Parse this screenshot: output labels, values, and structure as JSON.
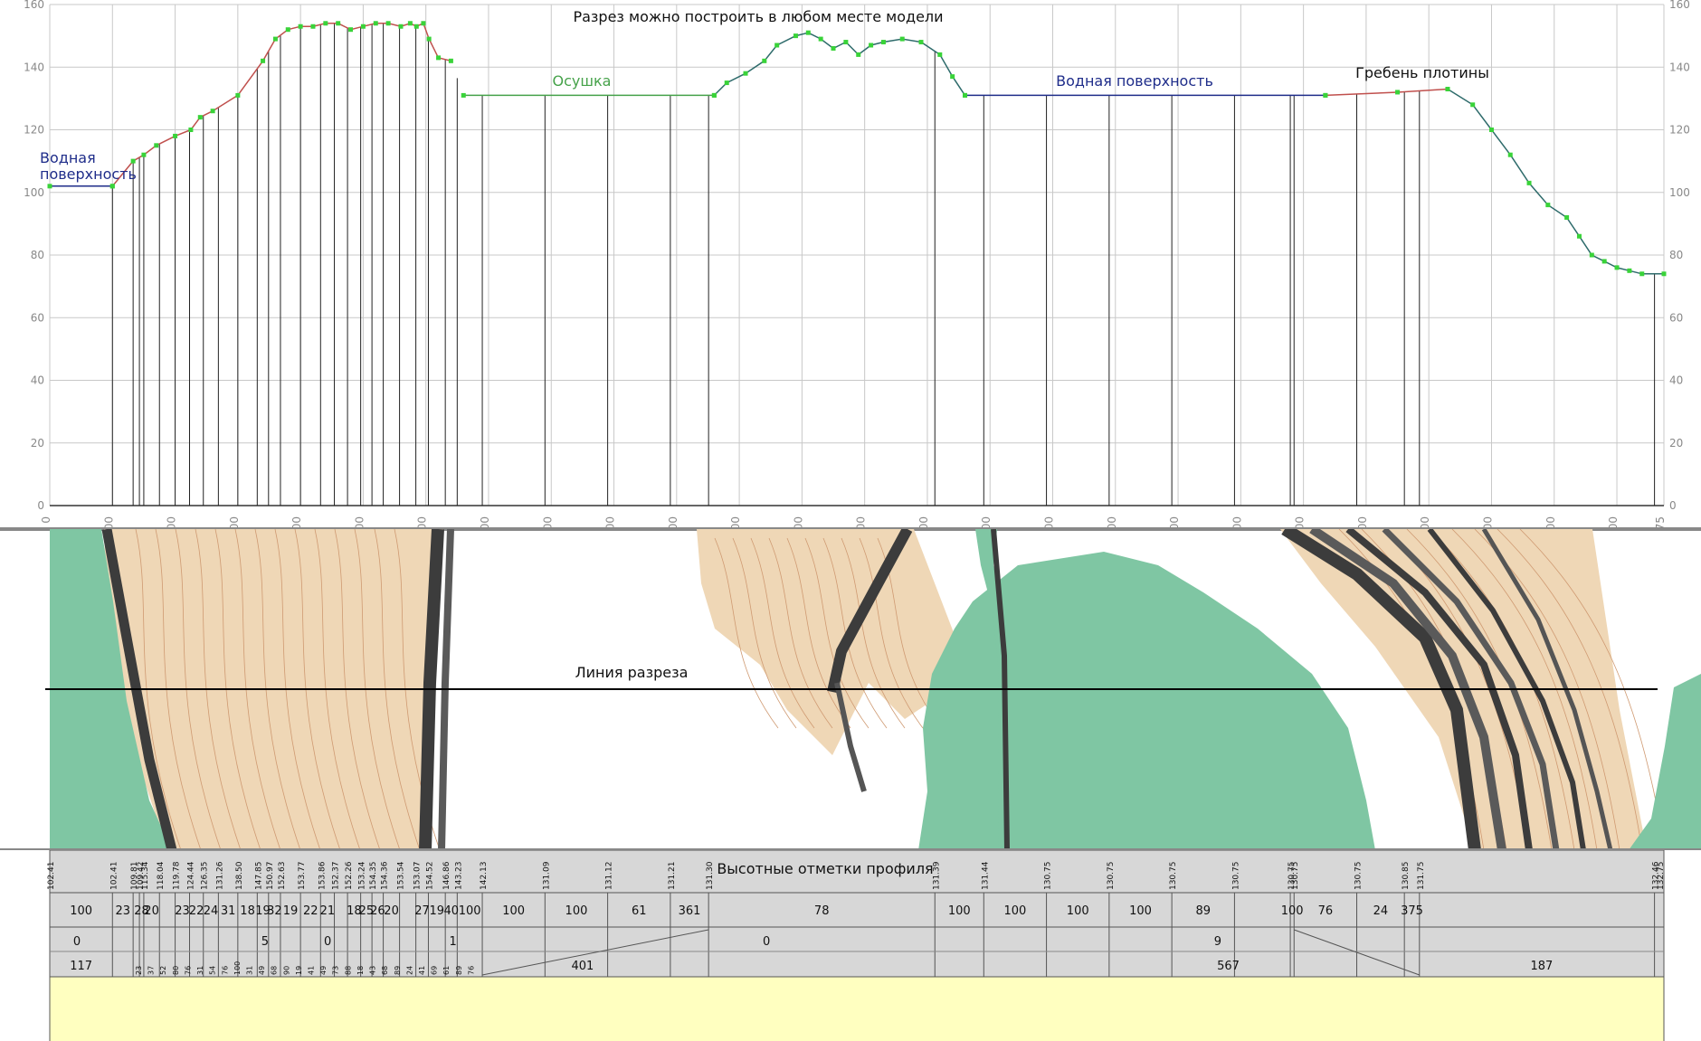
{
  "profile": {
    "title": "Разрез можно построить в любом месте модели",
    "annotations": {
      "water_left_line1": "Водная",
      "water_left_line2": "поверхность",
      "drainage": "Осушка",
      "water_right": "Водная поверхность",
      "dam_crest": "Гребень плотины"
    },
    "y_ticks": [
      "0",
      "20",
      "40",
      "60",
      "80",
      "100",
      "120",
      "140",
      "160"
    ],
    "x_ticks": [
      "0",
      "100",
      "200",
      "300",
      "400",
      "500",
      "600",
      "700",
      "800",
      "900",
      "1000",
      "1100",
      "1200",
      "1300",
      "1400",
      "1500",
      "1600",
      "1700",
      "1800",
      "1900",
      "2000",
      "2100",
      "2200",
      "2300",
      "2400",
      "2500",
      "2575"
    ],
    "colors": {
      "terrain": "#c0504d",
      "water": "#1f2d8a",
      "drain": "#46a24a",
      "natural": "#2e6b6b",
      "points": "#39d339",
      "grid": "#c8c8c8"
    }
  },
  "chart_data": {
    "type": "line",
    "title": "Разрез можно построить в любом месте модели",
    "xlabel": "",
    "ylabel": "",
    "xlim": [
      0,
      2575
    ],
    "ylim": [
      0,
      160
    ],
    "grid": true,
    "series": [
      {
        "name": "terrain",
        "x": [
          100,
          133,
          150,
          170,
          200,
          225,
          240,
          260,
          300,
          340,
          360,
          380,
          400,
          420,
          440,
          460,
          480,
          500,
          520,
          540,
          560,
          575,
          585,
          596,
          605,
          620,
          640
        ],
        "y": [
          102,
          110,
          112,
          115,
          118,
          120,
          124,
          126,
          131,
          142,
          149,
          152,
          153,
          153,
          154,
          154,
          152,
          153,
          154,
          154,
          153,
          154,
          153,
          154,
          149,
          143,
          142
        ]
      },
      {
        "name": "Водная поверхность (left)",
        "x": [
          0,
          100
        ],
        "y": [
          102,
          102
        ]
      },
      {
        "name": "Осушка",
        "x": [
          660,
          1060
        ],
        "y": [
          131,
          131
        ]
      },
      {
        "name": "hill",
        "x": [
          1060,
          1080,
          1110,
          1140,
          1160,
          1190,
          1210,
          1230,
          1250,
          1270,
          1290,
          1310,
          1330,
          1360,
          1390,
          1420,
          1440,
          1460
        ],
        "y": [
          131,
          135,
          138,
          142,
          147,
          150,
          151,
          149,
          146,
          148,
          144,
          147,
          148,
          149,
          148,
          144,
          137,
          131
        ]
      },
      {
        "name": "Водная поверхность (right)",
        "x": [
          1460,
          2035
        ],
        "y": [
          131,
          131
        ]
      },
      {
        "name": "dam",
        "x": [
          2035,
          2150,
          2230
        ],
        "y": [
          131,
          132,
          133
        ]
      },
      {
        "name": "slope",
        "x": [
          2230,
          2270,
          2300,
          2330,
          2360,
          2390,
          2420,
          2440,
          2460,
          2480,
          2500,
          2520,
          2540,
          2575
        ],
        "y": [
          133,
          128,
          120,
          112,
          103,
          96,
          92,
          86,
          80,
          78,
          76,
          75,
          74,
          74
        ]
      }
    ],
    "stations": [
      100,
      133,
      143,
      150,
      175,
      200,
      223,
      245,
      269,
      300,
      331,
      349,
      368,
      400,
      432,
      454,
      475,
      496,
      514,
      532,
      558,
      584,
      604,
      631,
      650,
      690,
      790,
      890,
      990,
      1051,
      1412,
      1490,
      1590,
      1690,
      1790,
      1890,
      1979,
      1985,
      2085,
      2161,
      2185,
      2560
    ]
  },
  "plan": {
    "section_label": "Линия разреза",
    "colors": {
      "water": "#7fc6a3",
      "relief": "#efd7b6",
      "contour": "#cf9a72",
      "dark": "#3c3c3c"
    }
  },
  "table": {
    "header": "Высотные отметки профиля",
    "elevations": [
      "102.41",
      "102.41",
      "109.81",
      "109.42",
      "115.34",
      "118.04",
      "119.78",
      "124.44",
      "126.35",
      "131.26",
      "138.50",
      "147.85",
      "150.97",
      "152.63",
      "153.77",
      "153.86",
      "152.37",
      "152.26",
      "153.24",
      "154.35",
      "154.36",
      "153.54",
      "153.07",
      "154.52",
      "146.86",
      "143.23",
      "142.13",
      "131.09",
      "131.12",
      "131.21",
      "131.30",
      "131.39",
      "131.44",
      "130.75",
      "130.75",
      "130.75",
      "130.75",
      "130.75",
      "130.75",
      "130.75",
      "130.85",
      "131.75",
      "132.46",
      "132.75"
    ],
    "distances": [
      "100",
      "23",
      "",
      "28",
      "20",
      "",
      "23",
      "22",
      "24",
      "31",
      "18",
      "19",
      "32",
      "19",
      "22",
      "21",
      "",
      "18",
      "25",
      "26",
      "20",
      "",
      "27",
      "19",
      "40",
      "100",
      "100",
      "100",
      "61",
      "361",
      "78",
      "100",
      "100",
      "100",
      "100",
      "89",
      "",
      "100",
      "76",
      "24",
      "375"
    ],
    "slope_top": [
      {
        "label": "0"
      },
      {
        "label": "5"
      },
      {
        "label": "0"
      },
      {
        "label": "1"
      },
      {
        "label": "0"
      },
      {
        "label": "9"
      }
    ],
    "slope_bottom_main": [
      {
        "label": "117"
      },
      {
        "label": "401"
      },
      {
        "label": "567"
      },
      {
        "label": "187"
      }
    ],
    "slope_bottom_small": [
      "23",
      "37",
      "52",
      "80",
      "76",
      "31",
      "54",
      "76",
      "100",
      "31",
      "49",
      "68",
      "90",
      "19",
      "41",
      "49",
      "73",
      "88",
      "18",
      "43",
      "68",
      "89",
      "24",
      "41",
      "69",
      "61",
      "89",
      "76"
    ]
  }
}
